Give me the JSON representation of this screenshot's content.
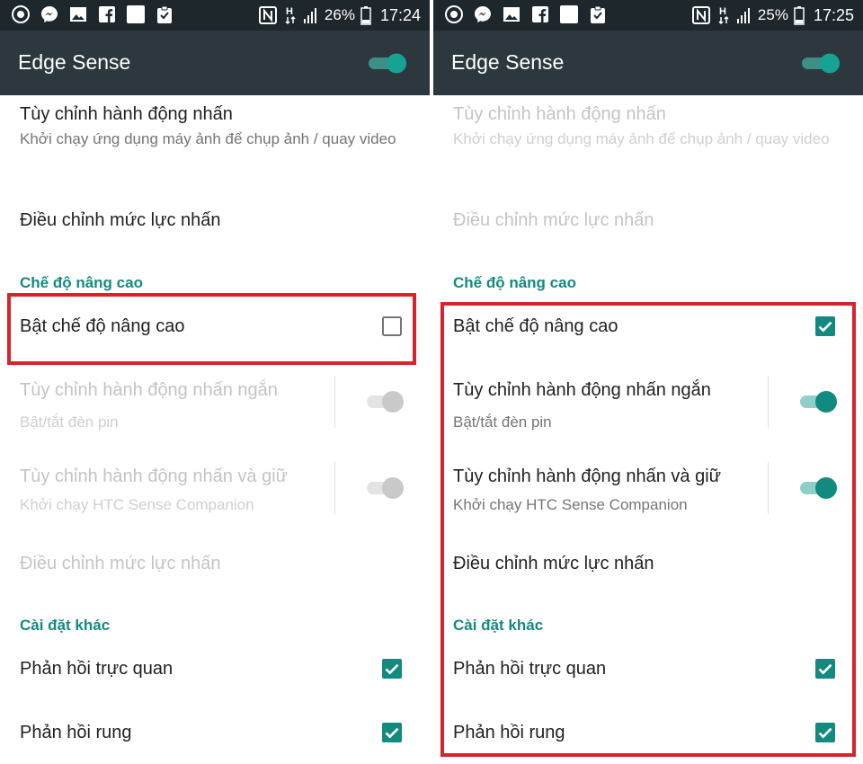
{
  "panels": [
    {
      "status": {
        "network": "H",
        "battery_percent": "26%",
        "time": "17:24"
      },
      "app_bar": {
        "title": "Edge Sense",
        "enabled": true
      },
      "rows": {
        "customize_tap": {
          "title": "Tùy chỉnh hành động nhấn",
          "subtitle": "Khởi chạy ứng dụng máy ảnh để chụp ảnh / quay video",
          "enabled": true
        },
        "adjust_force_top": {
          "title": "Điều chỉnh mức lực nhấn",
          "enabled": true
        },
        "section_advanced": "Chế độ nâng cao",
        "enable_advanced": {
          "title": "Bật chế độ nâng cao",
          "checked": false
        },
        "short_tap": {
          "title": "Tùy chỉnh hành động nhấn ngắn",
          "subtitle": "Bật/tắt đèn pin",
          "enabled": false,
          "toggle_on": false
        },
        "tap_hold": {
          "title": "Tùy chỉnh hành động nhấn và giữ",
          "subtitle": "Khởi chạy HTC Sense Companion",
          "enabled": false,
          "toggle_on": false
        },
        "adjust_force_bottom": {
          "title": "Điều chỉnh mức lực nhấn",
          "enabled": false
        },
        "section_other": "Cài đặt khác",
        "visual_feedback": {
          "title": "Phản hồi trực quan",
          "checked": true
        },
        "vibration_feedback": {
          "title": "Phản hồi rung",
          "checked": true
        }
      }
    },
    {
      "status": {
        "network": "H",
        "battery_percent": "25%",
        "time": "17:25"
      },
      "app_bar": {
        "title": "Edge Sense",
        "enabled": true
      },
      "rows": {
        "customize_tap": {
          "title": "Tùy chỉnh hành động nhấn",
          "subtitle": "Khởi chạy ứng dụng máy ảnh để chụp ảnh / quay video",
          "enabled": false
        },
        "adjust_force_top": {
          "title": "Điều chỉnh mức lực nhấn",
          "enabled": false
        },
        "section_advanced": "Chế độ nâng cao",
        "enable_advanced": {
          "title": "Bật chế độ nâng cao",
          "checked": true
        },
        "short_tap": {
          "title": "Tùy chỉnh hành động nhấn ngắn",
          "subtitle": "Bật/tắt đèn pin",
          "enabled": true,
          "toggle_on": true
        },
        "tap_hold": {
          "title": "Tùy chỉnh hành động nhấn và giữ",
          "subtitle": "Khởi chạy HTC Sense Companion",
          "enabled": true,
          "toggle_on": true
        },
        "adjust_force_bottom": {
          "title": "Điều chỉnh mức lực nhấn",
          "enabled": true
        },
        "section_other": "Cài đặt khác",
        "visual_feedback": {
          "title": "Phản hồi trực quan",
          "checked": true
        },
        "vibration_feedback": {
          "title": "Phản hồi rung",
          "checked": true
        }
      }
    }
  ],
  "colors": {
    "accent": "#138a80",
    "status_bar": "#1e272b",
    "app_bar": "#2c383e",
    "highlight": "#d8232a"
  },
  "icons": [
    "camera-shutter-icon",
    "messenger-icon",
    "gallery-icon",
    "facebook-icon",
    "blank-notification-icon",
    "clipboard-check-icon",
    "nfc-icon",
    "signal-icon",
    "battery-icon"
  ]
}
